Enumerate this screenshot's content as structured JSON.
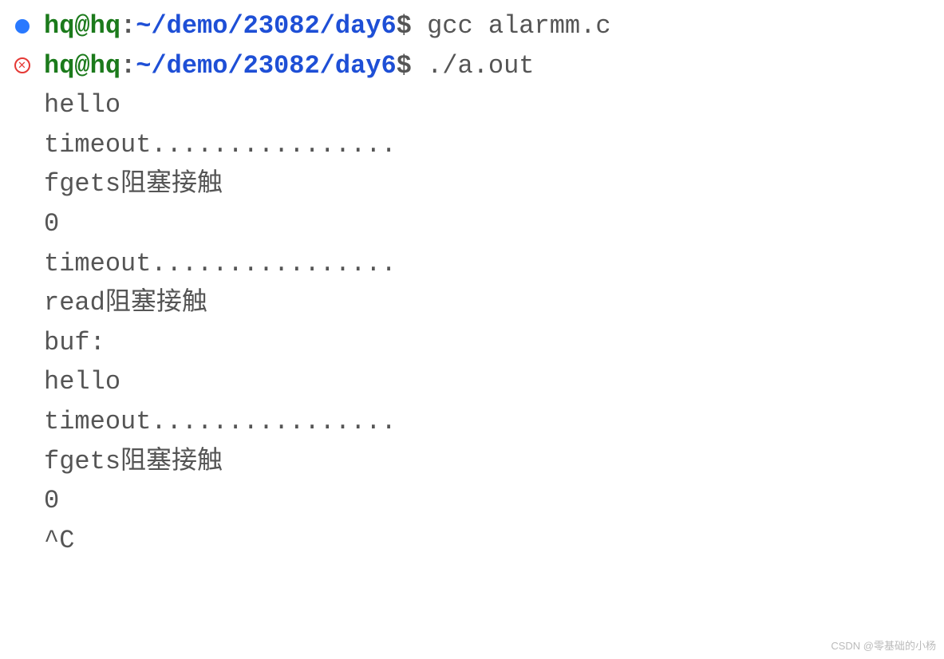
{
  "prompt": {
    "user_host": "hq@hq",
    "separator": ":",
    "path": "~/demo/23082/day6",
    "symbol": "$"
  },
  "commands": {
    "cmd1": " gcc alarmm.c",
    "cmd2": " ./a.out"
  },
  "output": {
    "line1": "hello",
    "line2": "timeout................",
    "line3": "fgets阻塞接触",
    "line4": "0",
    "line5": "timeout................",
    "line6": "read阻塞接触",
    "line7": "buf:",
    "line8": "hello",
    "line9": "timeout................",
    "line10": "fgets阻塞接触",
    "line11": "0",
    "line12": "^C"
  },
  "watermark": "CSDN @零基础的小杨"
}
